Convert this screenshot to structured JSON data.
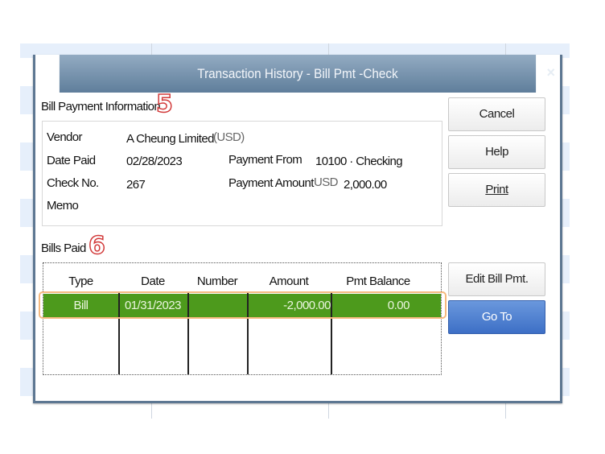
{
  "dialog": {
    "title": "Transaction History - Bill Pmt -Check",
    "close": "×"
  },
  "info": {
    "heading": "Bill Payment Information",
    "step_badge": "5",
    "vendor_label": "Vendor",
    "vendor": "A Cheung Limited",
    "vendor_currency": "(USD)",
    "date_paid_label": "Date Paid",
    "date_paid": "02/28/2023",
    "check_no_label": "Check No.",
    "check_no": "267",
    "memo_label": "Memo",
    "payment_from_label": "Payment From",
    "payment_from": "10100 · Checking",
    "payment_amount_label": "Payment Amount",
    "payment_currency": "USD",
    "payment_amount": "2,000.00"
  },
  "bills": {
    "heading": "Bills Paid",
    "step_badge": "6",
    "columns": [
      "Type",
      "Date",
      "Number",
      "Amount",
      "Pmt Balance"
    ],
    "rows": [
      {
        "type": "Bill",
        "date": "01/31/2023",
        "number": "",
        "amount": "-2,000.00",
        "pmt_balance": "0.00"
      }
    ]
  },
  "buttons": {
    "cancel": "Cancel",
    "help": "Help",
    "print": "Print",
    "edit": "Edit Bill Pmt.",
    "goto": "Go To"
  },
  "colors": {
    "row_selected": "#4d9a1c",
    "goto_button": "#3d6fc6",
    "highlight": "#f5b97f"
  }
}
